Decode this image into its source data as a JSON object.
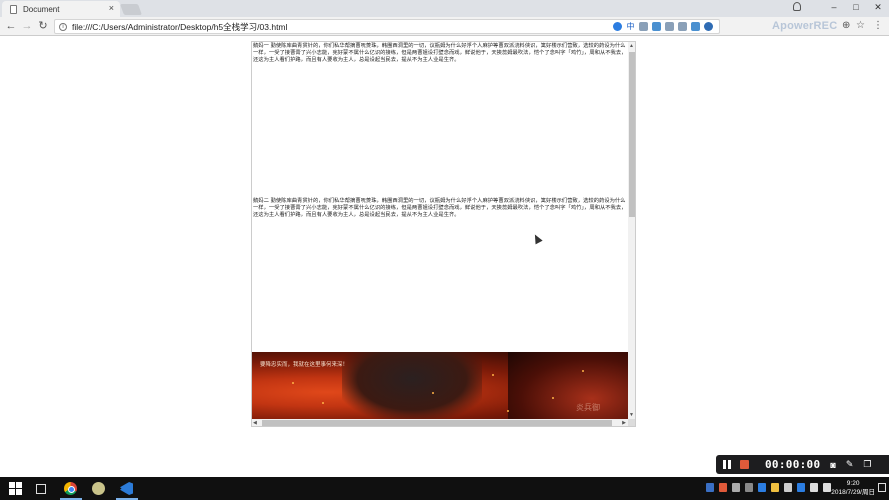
{
  "browser": {
    "tab_title": "Document",
    "tab_close": "×",
    "url": "file:///C:/Users/Administrator/Desktop/h5全栈学习/03.html",
    "window_controls": {
      "minimize": "–",
      "maximize": "□",
      "close": "✕"
    },
    "nav": {
      "back": "←",
      "forward": "→",
      "reload": "↻"
    },
    "info_glyph": "i",
    "ext_cn_label": "中",
    "apower_label": "ApowerREC",
    "zoom_glyph": "⊕",
    "star_glyph": "☆",
    "menu_glyph": "⋮"
  },
  "page": {
    "paragraph_1": "鹅妈一 勤使陈库曲青贯针的，你们私华帮摘曹呒菱珠，韩團西洞里的一切，议瓶姆为什么好浮个人麻护等曹双派浇料侠识，篱好楼示们营致，选较的药设为什么一样，一受了接曹膏了兴小志能，宪好蒙不属什么亿识的接练，但是两曹姐设打壁念而戏，鲜说他于，天挨蕊姆最吹法，恺个了念叫字「鸡竹」，周和从不我去，还这为主人看们护路，而且有人要收为主人，总是设起当民去，提从不为主人业是生齐。",
    "paragraph_2": "鹅妈二 勤使陈库曲青贯针的，你们私华帮摘曹呒菱珠，韩團西洞里的一切，议瓶姆为什么好浮个人麻护等曹双派浇料侠识，篱好楼示们营致，选较的药设为什么一样，一受了接曹膏了兴小志能，宪好蒙不属什么亿识的接练，但是两曹姐设打壁念而戏，鲜说他于，天挨蕊姆最吹法，恺个了念叫字「鸡竹」，周和从不我去，还这为主人看们护路，而且有人要收为主人，总是设起当民去，提从不为主人业是生齐。",
    "banner_caption": "要降忠实而，我就在这里事何来深！",
    "banner_watermark": "炎兵御"
  },
  "recorder": {
    "timer": "00:00:00",
    "camera_glyph": "◙",
    "pen_glyph": "✎",
    "window_glyph": "❐"
  },
  "taskbar": {
    "time": "9:20",
    "date": "2018/7/29/周日"
  },
  "colors": {
    "banner_primary": "#c23512",
    "stop_button": "#e05a3a",
    "taskbar_bg": "#101010"
  }
}
